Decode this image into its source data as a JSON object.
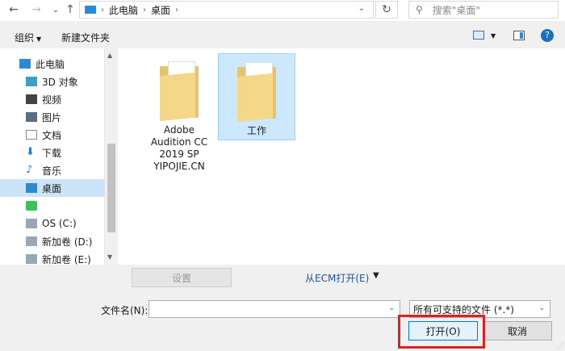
{
  "address": {
    "breadcrumb": [
      "此电脑",
      "桌面"
    ],
    "search_placeholder": "搜索\"桌面\""
  },
  "toolbar": {
    "organize_label": "组织",
    "new_folder_label": "新建文件夹"
  },
  "nav": {
    "items": [
      {
        "label": "此电脑",
        "icon": "pc-icon"
      },
      {
        "label": "3D 对象",
        "icon": "3d-objects-icon"
      },
      {
        "label": "视频",
        "icon": "video-icon"
      },
      {
        "label": "图片",
        "icon": "pictures-icon"
      },
      {
        "label": "文档",
        "icon": "documents-icon"
      },
      {
        "label": "下载",
        "icon": "download-icon"
      },
      {
        "label": "音乐",
        "icon": "music-icon"
      },
      {
        "label": "桌面",
        "icon": "desktop-icon",
        "selected": true
      },
      {
        "label": "",
        "icon": "app-icon"
      },
      {
        "label": "OS (C:)",
        "icon": "drive-icon"
      },
      {
        "label": "新加卷 (D:)",
        "icon": "drive-icon"
      },
      {
        "label": "新加卷 (E:)",
        "icon": "drive-icon"
      }
    ]
  },
  "files": [
    {
      "name": "Adobe Audition CC 2019 SP YIPOJIE.CN",
      "lines": [
        "Adobe",
        "Audition CC",
        "2019 SP",
        "YIPOJIE.CN"
      ],
      "selected": false
    },
    {
      "name": "工作",
      "lines": [
        "工作"
      ],
      "selected": true
    }
  ],
  "bottom": {
    "settings_label": "设置",
    "ecm_open_label": "从ECM打开(E)",
    "filename_label": "文件名(N):",
    "filename_value": "",
    "filetype_value": "所有可支持的文件 (*.*)",
    "open_label": "打开(O)",
    "cancel_label": "取消"
  },
  "colors": {
    "accent_selected": "#cce8ff",
    "highlight": "#e02020"
  }
}
